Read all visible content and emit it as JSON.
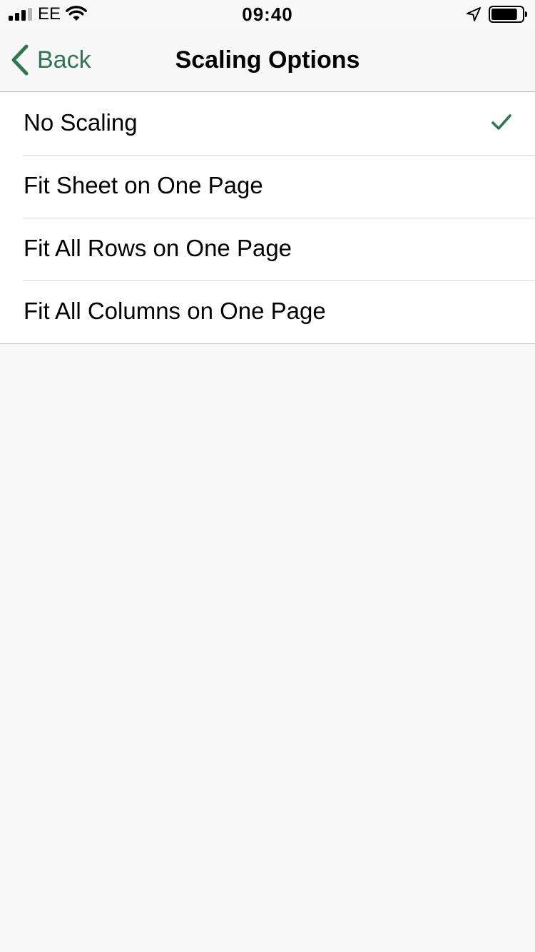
{
  "status_bar": {
    "carrier": "EE",
    "time": "09:40",
    "signal_bars_active": 3,
    "signal_bars_total": 4,
    "battery_level": 0.85
  },
  "nav": {
    "back_label": "Back",
    "title": "Scaling Options"
  },
  "options": [
    {
      "label": "No Scaling",
      "selected": true
    },
    {
      "label": "Fit Sheet on One Page",
      "selected": false
    },
    {
      "label": "Fit All Rows on One Page",
      "selected": false
    },
    {
      "label": "Fit All Columns on One Page",
      "selected": false
    }
  ],
  "colors": {
    "accent": "#2f7650",
    "background": "#f8f8f8",
    "list_background": "#ffffff",
    "separator": "#d9d9dc"
  },
  "icons": {
    "back": "chevron-left-icon",
    "selected": "checkmark-icon",
    "wifi": "wifi-icon",
    "location": "location-arrow-icon",
    "battery": "battery-icon",
    "signal": "signal-bars-icon"
  }
}
